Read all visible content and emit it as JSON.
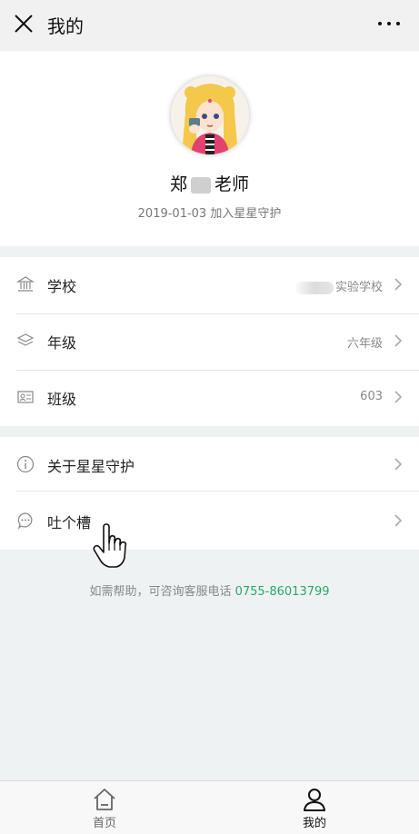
{
  "header": {
    "title": "我的"
  },
  "profile": {
    "name_prefix": "郑",
    "name_suffix": "老师",
    "join_text": "2019-01-03 加入星星守护"
  },
  "info_rows": [
    {
      "label": "学校",
      "value": "实验学校",
      "icon": "bank-icon"
    },
    {
      "label": "年级",
      "value": "六年级",
      "icon": "layers-icon"
    },
    {
      "label": "班级",
      "value": "603",
      "icon": "class-card-icon"
    }
  ],
  "about_rows": [
    {
      "label": "关于星星守护",
      "icon": "info-icon"
    },
    {
      "label": "吐个槽",
      "icon": "chat-bubble-icon"
    }
  ],
  "help": {
    "text": "如需帮助，可咨询客服电话 ",
    "phone": "0755-86013799"
  },
  "tabbar": {
    "home": "首页",
    "mine": "我的"
  },
  "colors": {
    "accent_green": "#2aa66a",
    "background": "#eef2f2"
  }
}
